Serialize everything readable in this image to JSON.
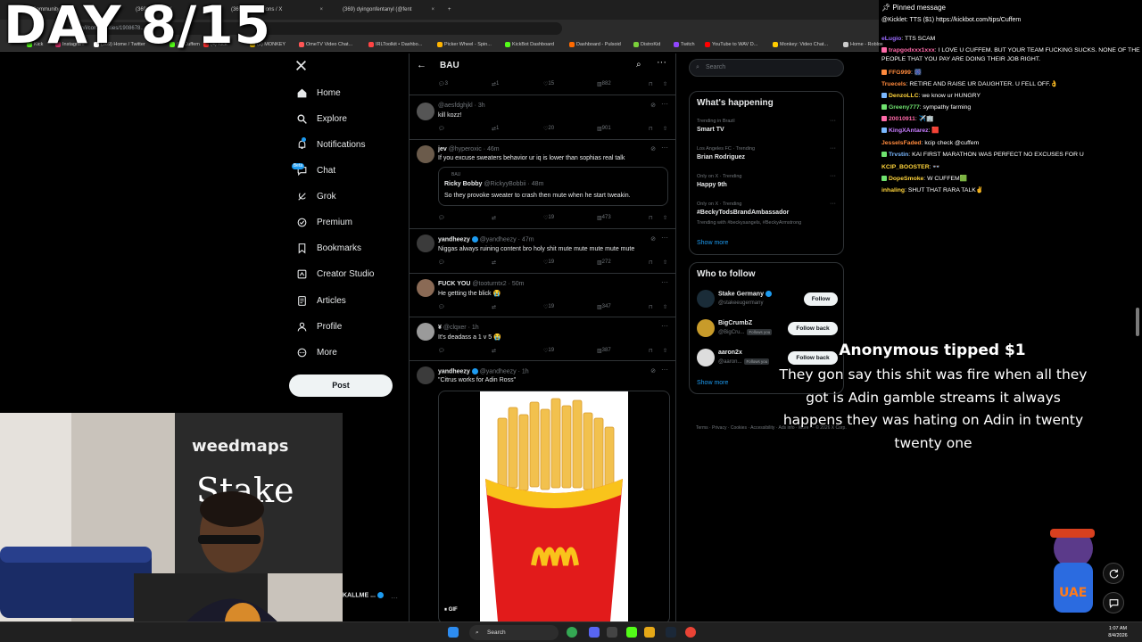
{
  "overlay": {
    "day_text": "DAY 8/15"
  },
  "browser": {
    "tabs": [
      {
        "label": "(71) BAU Community / X"
      },
      {
        "label": "(369) Home / X"
      },
      {
        "label": "(369) Notifications / X"
      },
      {
        "label": "(369) dyingonfentanyl (@fent"
      }
    ],
    "url": "x.com/i/communities/1908678...",
    "bookmarks": [
      "Kick",
      "Instagram",
      "(369) Home / Twitter",
      "(2) Cuffem",
      "(4) Kick",
      "(2) MONKEY",
      "OmeTV Video Chat...",
      "IRLToolkit • Dashbo...",
      "Picker Wheel - Spin...",
      "KickBot Dashboard",
      "Dashboard - Pulsoid",
      "DistroKid",
      "Twitch",
      "YouTube to WAV D...",
      "Monkey: Video Chat...",
      "Home - Roblox",
      "All Bookmarks"
    ]
  },
  "leftnav": {
    "items": [
      {
        "label": "Home",
        "icon": "home-icon"
      },
      {
        "label": "Explore",
        "icon": "search-icon"
      },
      {
        "label": "Notifications",
        "icon": "bell-icon"
      },
      {
        "label": "Chat",
        "icon": "chat-icon"
      },
      {
        "label": "Grok",
        "icon": "grok-icon"
      },
      {
        "label": "Premium",
        "icon": "premium-icon"
      },
      {
        "label": "Bookmarks",
        "icon": "bookmark-icon"
      },
      {
        "label": "Creator Studio",
        "icon": "creator-studio-icon"
      },
      {
        "label": "Articles",
        "icon": "articles-icon"
      },
      {
        "label": "Profile",
        "icon": "profile-icon"
      },
      {
        "label": "More",
        "icon": "more-icon"
      }
    ],
    "chat_badge": "Beta",
    "post_label": "Post"
  },
  "feed": {
    "title": "BAU",
    "top_actions": {
      "replies": "3",
      "reposts": "1",
      "likes": "15",
      "views": "882"
    },
    "tweets": [
      {
        "name": "",
        "handle": "@aesfdghjkl",
        "time": "3h",
        "text": "kill kozz!",
        "replies": "",
        "reposts": "1",
        "likes": "20",
        "views": "901"
      },
      {
        "name": "jev",
        "handle": "@hyperoxic",
        "time": "46m",
        "text": "If you excuse sweaters behavior ur iq is lower than sophias real talk",
        "quote": {
          "label": "BAU",
          "name": "Ricky Bobby",
          "handle": "@RickyyBobbii",
          "time": "48m",
          "text": "So they provoke sweater to crash then mute when he start tweakin."
        },
        "replies": "",
        "reposts": "",
        "likes": "19",
        "views": "473"
      },
      {
        "name": "yandheezy",
        "handle": "@yandheezy",
        "time": "47m",
        "text": "Niggas always ruining content bro holy shit mute mute mute mute mute",
        "replies": "",
        "reposts": "",
        "likes": "19",
        "views": "272"
      },
      {
        "name": "FUCK YOU",
        "handle": "@tooturntx2",
        "time": "50m",
        "text": "He getting the blick 😭",
        "replies": "",
        "reposts": "",
        "likes": "19",
        "views": "347"
      },
      {
        "name": "¥",
        "handle": "@clqxer",
        "time": "1h",
        "text": "It's deadass a 1 v 5 😭",
        "replies": "",
        "reposts": "",
        "likes": "19",
        "views": "387"
      },
      {
        "name": "yandheezy",
        "handle": "@yandheezy",
        "time": "1h",
        "text": "\"Citrus works for Adin Ross\""
      }
    ],
    "gif_label": "GIF"
  },
  "right": {
    "search_placeholder": "Search",
    "happening_title": "What's happening",
    "trends": [
      {
        "context": "Trending in Brazil",
        "name": "Smart TV",
        "sub": ""
      },
      {
        "context": "Los Angeles FC · Trending",
        "name": "Brian Rodriguez",
        "sub": ""
      },
      {
        "context": "Only on X · Trending",
        "name": "Happy 9th",
        "sub": ""
      },
      {
        "context": "Only on X · Trending",
        "name": "#BeckyTodsBrandAmbassador",
        "sub": "Trending with #beckysangels, #BeckyArmstrong"
      }
    ],
    "show_more": "Show more",
    "wtf_title": "Who to follow",
    "wtf": [
      {
        "name": "Stake Germany",
        "handle": "@stakeeugermany",
        "button": "Follow",
        "follows_you": ""
      },
      {
        "name": "BigCrumbZ",
        "handle": "@BigCru...",
        "button": "Follow back",
        "follows_you": "Follows you"
      },
      {
        "name": "aaron2x",
        "handle": "@aaron...",
        "button": "Follow back",
        "follows_you": "Follows you"
      }
    ],
    "footer": "Terms · Privacy · Cookies · Accessibility · Ads info · More ··· © 2026 X Corp."
  },
  "chat": {
    "pinned_label": "Pinned message",
    "pinned_text": "@Kicklet: TTS ($1) https://kickbot.com/tips/Cuffem",
    "lines": [
      {
        "user": "eLugio",
        "text": "TTS SCAM",
        "color": "#9b6bff"
      },
      {
        "user": "trapgodxxx1xxx",
        "text": "I LOVE U CUFFEM. BUT YOUR TEAM FUCKING SUCKS. NONE OF THE PEOPLE THAT YOU PAY ARE DOING THEIR JOB RIGHT.",
        "color": "#ff6aa9"
      },
      {
        "user": "FFG999",
        "text": "🎆",
        "color": "#ff8a3d"
      },
      {
        "user": "Truecels",
        "text": "RETIRE AND RAISE UR DAUGHTER. U FELL OFF.👌",
        "color": "#ff8a3d"
      },
      {
        "user": "DenzoLLC",
        "text": "we know ur HUNGRY",
        "color": "#ffd43b"
      },
      {
        "user": "Greeny777",
        "text": "sympathy farming",
        "color": "#6fe36f"
      },
      {
        "user": "20010911",
        "text": "✈️🏢",
        "color": "#ff6aa9"
      },
      {
        "user": "KingXAntarez",
        "text": "🟥",
        "color": "#c77dff"
      },
      {
        "user": "JesselsFaded",
        "text": "kcip check @cuffem",
        "color": "#ff8a3d"
      },
      {
        "user": "Trvstin",
        "text": "KAI FIRST MARATHON WAS PERFECT NO EXCUSES FOR U",
        "color": "#7ab8ff"
      },
      {
        "user": "KCIP_BOOSTER",
        "text": "👓",
        "color": "#ffd43b"
      },
      {
        "user": "DopeSmoke",
        "text": "W CUFFEM🟩",
        "color": "#ffd43b"
      },
      {
        "user": "inhaling",
        "text": "SHUT THAT RARA TALK✌️",
        "color": "#ffd43b"
      }
    ]
  },
  "tip": {
    "title": "Anonymous tipped $1",
    "message": "They gon say this shit was fire when all they got is Adin gamble streams it always happens they was hating on Adin in twenty twenty one"
  },
  "webcam": {
    "handle": "KALLME ..."
  },
  "taskbar": {
    "search_placeholder": "Search",
    "time": "1:07 AM",
    "date": "8/4/2026"
  }
}
